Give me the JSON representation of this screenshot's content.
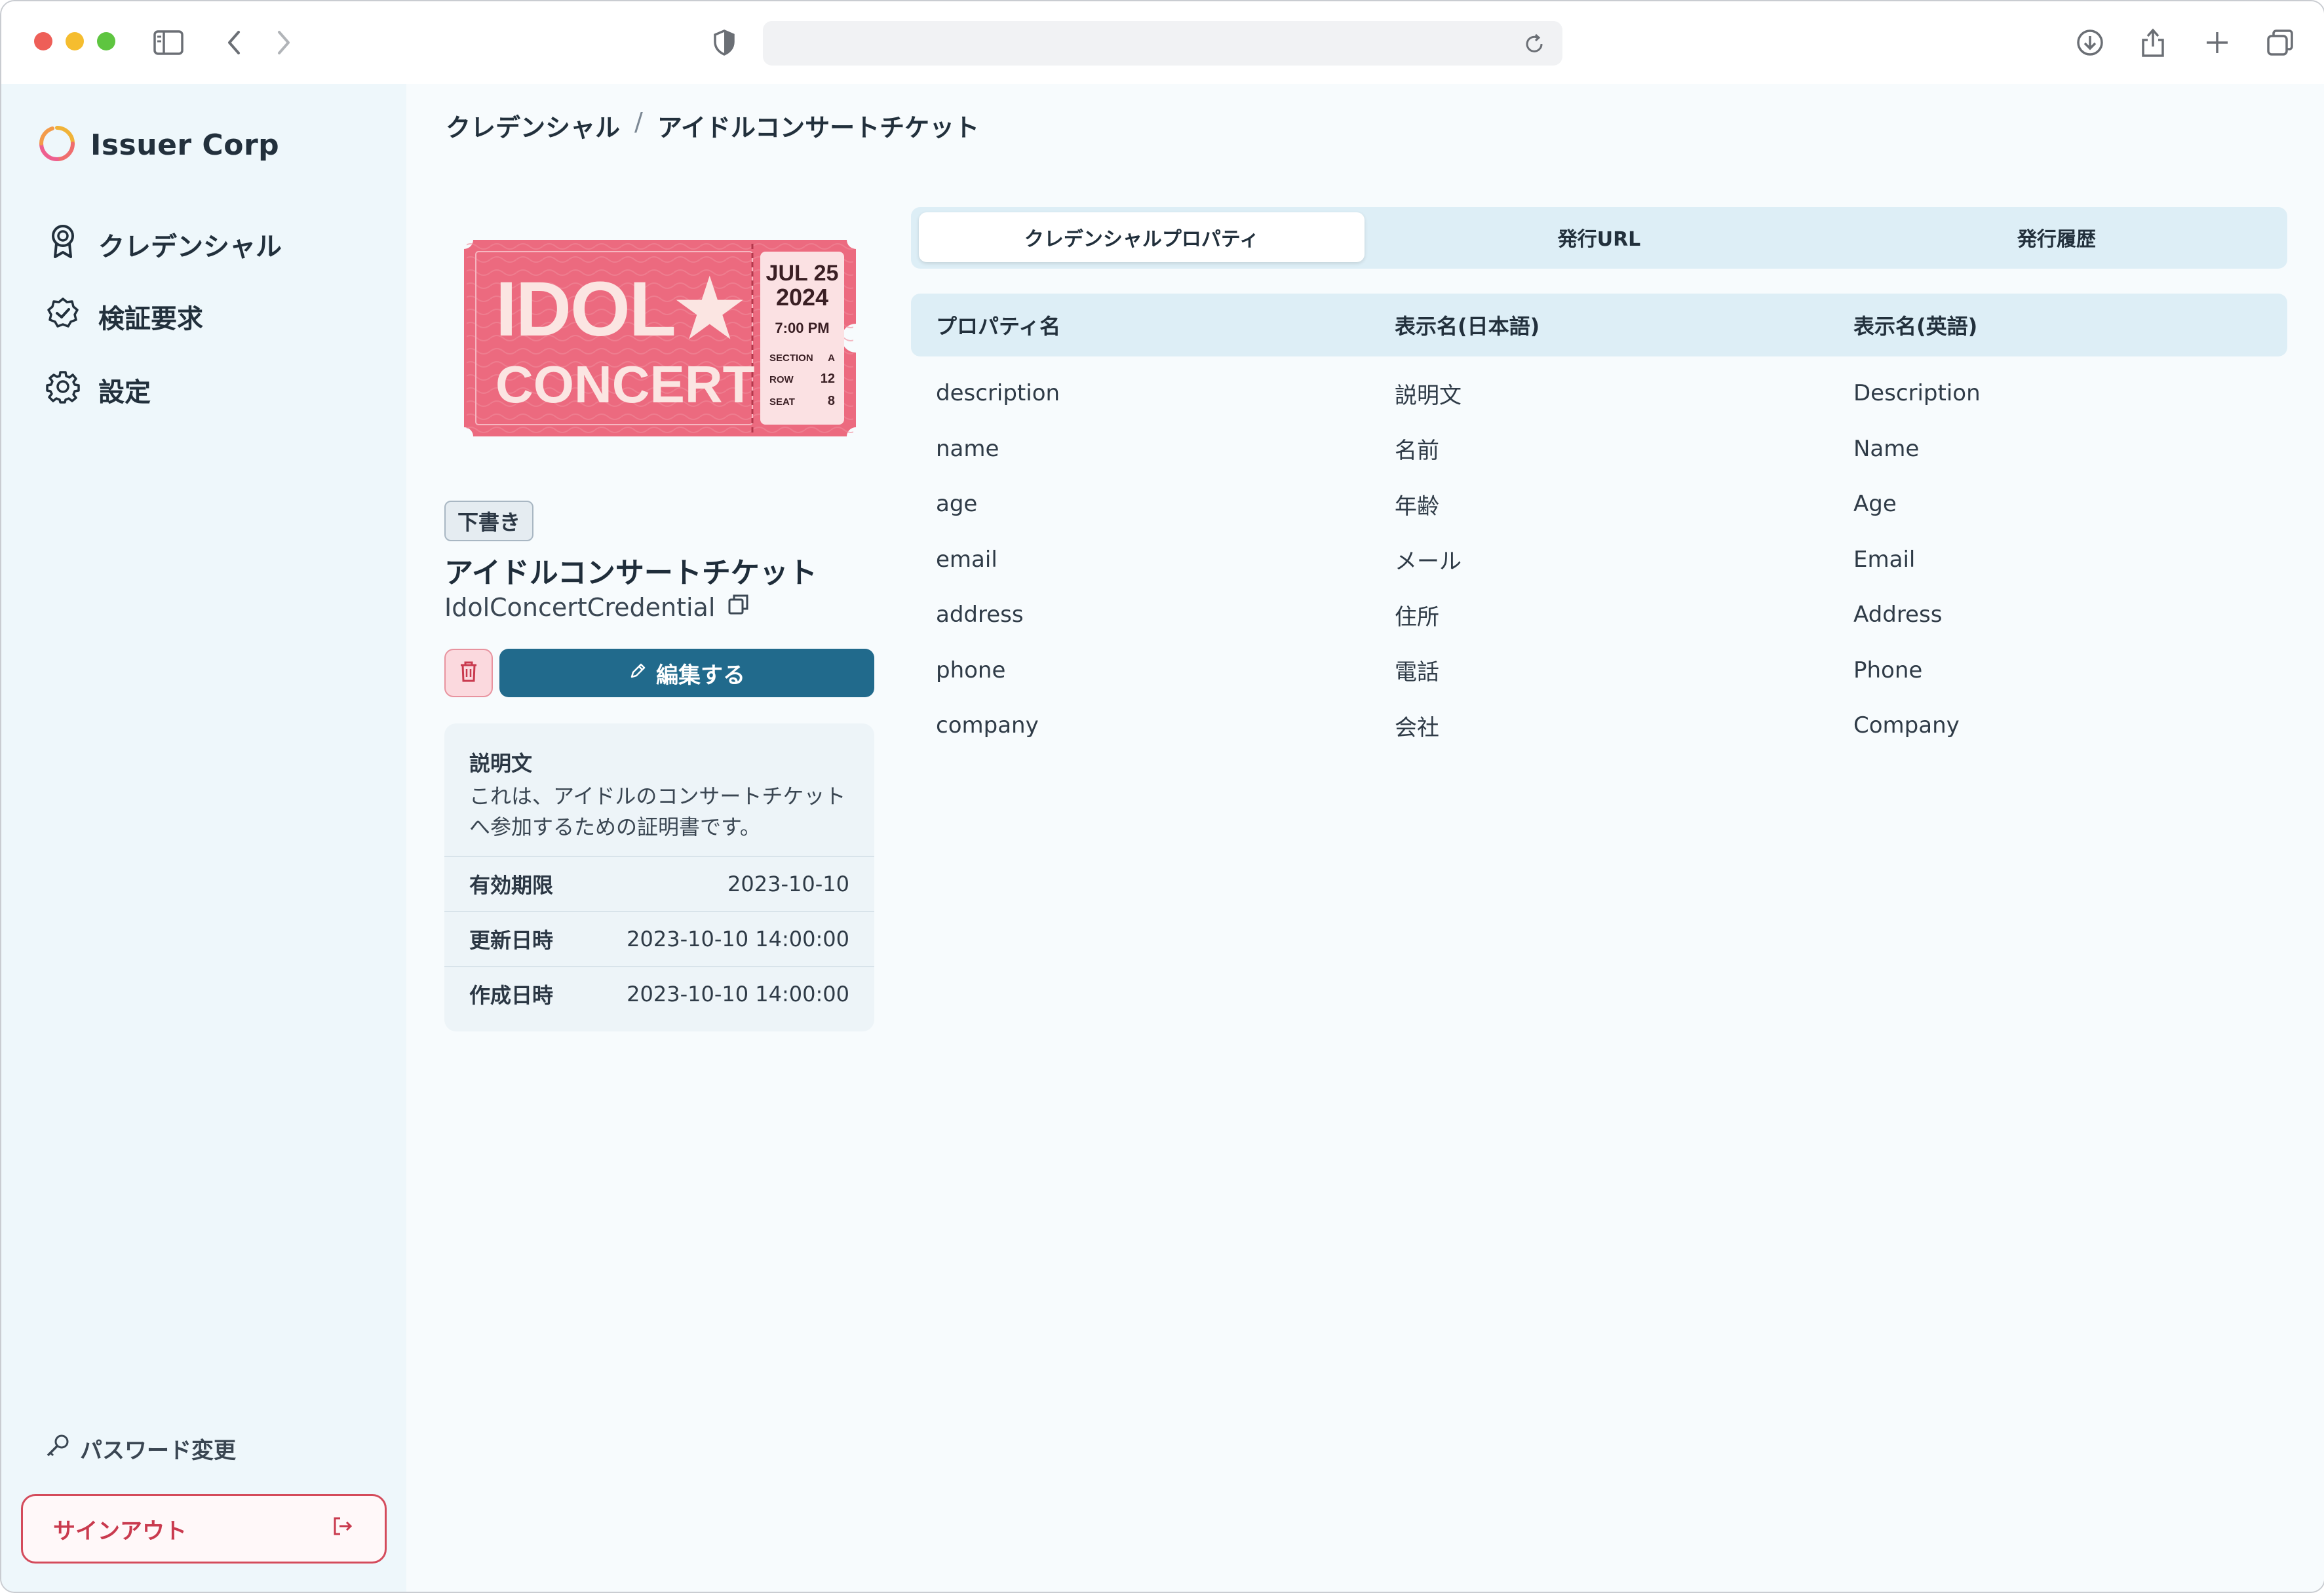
{
  "app": {
    "name": "Issuer Corp"
  },
  "sidebar": {
    "items": [
      {
        "label": "クレデンシャル",
        "icon": "badge-icon"
      },
      {
        "label": "検証要求",
        "icon": "verified-icon"
      },
      {
        "label": "設定",
        "icon": "gear-icon"
      }
    ],
    "password_change": "パスワード変更",
    "signout": "サインアウト"
  },
  "breadcrumb": {
    "root": "クレデンシャル",
    "sep": "/",
    "current": "アイドルコンサートチケット"
  },
  "ticket": {
    "line1": "IDOL★",
    "line2": "CONCERT",
    "date": "JUL 25",
    "year": "2024",
    "time": "7:00 PM",
    "section_label": "SECTION",
    "section_value": "A",
    "row_label": "ROW",
    "row_value": "12",
    "seat_label": "SEAT",
    "seat_value": "8"
  },
  "credential": {
    "status": "下書き",
    "title": "アイドルコンサートチケット",
    "id": "IdolConcertCredential",
    "edit_label": "編集する",
    "description_label": "説明文",
    "description": "これは、アイドルのコンサートチケットへ参加するための証明書です。",
    "rows": [
      {
        "label": "有効期限",
        "value": "2023-10-10"
      },
      {
        "label": "更新日時",
        "value": "2023-10-10 14:00:00"
      },
      {
        "label": "作成日時",
        "value": "2023-10-10 14:00:00"
      }
    ]
  },
  "tabs": [
    {
      "label": "クレデンシャルプロパティ",
      "active": true
    },
    {
      "label": "発行URL",
      "active": false
    },
    {
      "label": "発行履歴",
      "active": false
    }
  ],
  "table": {
    "headers": [
      "プロパティ名",
      "表示名(日本語)",
      "表示名(英語)"
    ],
    "rows": [
      [
        "description",
        "説明文",
        "Description"
      ],
      [
        "name",
        "名前",
        "Name"
      ],
      [
        "age",
        "年齢",
        "Age"
      ],
      [
        "email",
        "メール",
        "Email"
      ],
      [
        "address",
        "住所",
        "Address"
      ],
      [
        "phone",
        "電話",
        "Phone"
      ],
      [
        "company",
        "会社",
        "Company"
      ]
    ]
  },
  "colors": {
    "accent": "#216a8c",
    "danger": "#d44b5b",
    "ticket": "#ec6a7f"
  }
}
